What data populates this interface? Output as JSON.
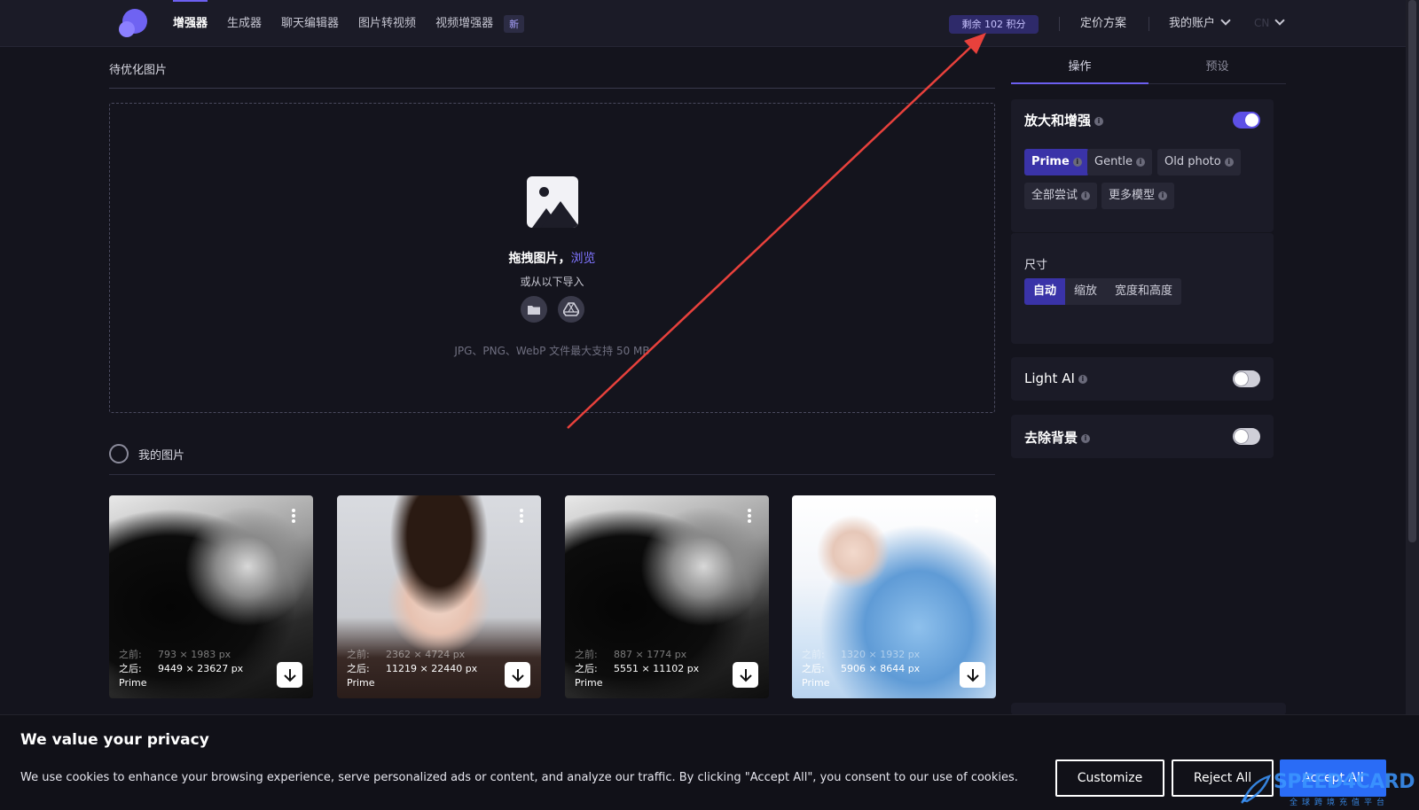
{
  "nav": {
    "items": [
      {
        "label": "增强器",
        "active": true
      },
      {
        "label": "生成器",
        "active": false
      },
      {
        "label": "聊天编辑器",
        "active": false
      },
      {
        "label": "图片转视频",
        "active": false
      },
      {
        "label": "视频增强器",
        "active": false
      }
    ],
    "new_badge": "新",
    "credits": "剩余 102 积分",
    "pricing": "定价方案",
    "account": "我的账户",
    "lang": "CN"
  },
  "main": {
    "section_title": "待优化图片",
    "dropzone": {
      "main_text": "拖拽图片，",
      "browse_link": "浏览",
      "sub_text": "或从以下导入",
      "note": "JPG、PNG、WebP 文件最大支持 50 MB"
    },
    "my_images_label": "我的图片",
    "before_label": "之前:",
    "after_label": "之后:",
    "cards": [
      {
        "before": "793 × 1983 px",
        "after": "9449 × 23627 px",
        "model": "Prime",
        "theme": "bw"
      },
      {
        "before": "2362 × 4724 px",
        "after": "11219 × 22440 px",
        "model": "Prime",
        "theme": "portrait"
      },
      {
        "before": "887 × 1774 px",
        "after": "5551 × 11102 px",
        "model": "Prime",
        "theme": "bw"
      },
      {
        "before": "1320 × 1932 px",
        "after": "5906 × 8644 px",
        "model": "Prime",
        "theme": "blue"
      }
    ]
  },
  "sidebar": {
    "tabs": [
      {
        "label": "操作",
        "active": true
      },
      {
        "label": "预设",
        "active": false
      }
    ],
    "upscale": {
      "title": "放大和增强",
      "enabled": true,
      "models": [
        "Prime",
        "Gentle",
        "Old photo",
        "全部尝试",
        "更多模型"
      ],
      "selected_model": "Prime"
    },
    "size": {
      "title": "尺寸",
      "options": [
        "自动",
        "缩放",
        "宽度和高度"
      ],
      "selected": "自动"
    },
    "light_ai": {
      "title": "Light AI",
      "enabled": false
    },
    "remove_bg": {
      "title": "去除背景",
      "enabled": false
    }
  },
  "cookie": {
    "title": "We value your privacy",
    "text": "We use cookies to enhance your browsing experience, serve personalized ads or content, and analyze our traffic. By clicking \"Accept All\", you consent to our use of cookies.",
    "customize": "Customize",
    "reject": "Reject All",
    "accept": "Accept All"
  },
  "watermark": {
    "brand": "SPEED4CARD",
    "tagline": "全球跨境充值平台"
  },
  "colors": {
    "accent": "#6c5ff0",
    "selected_chip": "#3a33a8",
    "annotation_arrow": "#e8413c",
    "accept_button": "#2a6cf6"
  }
}
